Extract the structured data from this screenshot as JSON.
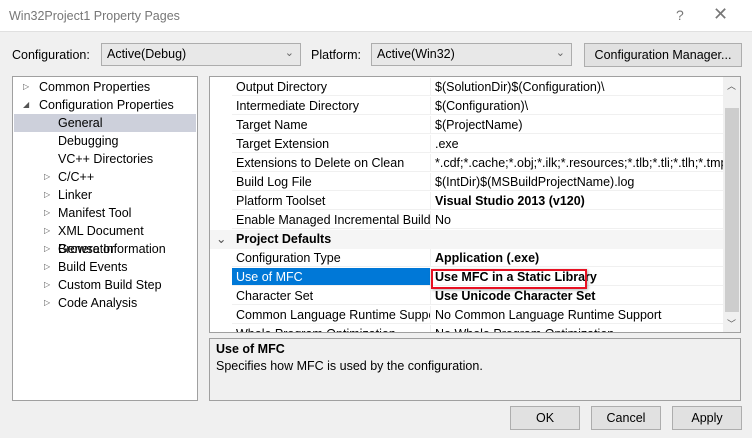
{
  "window": {
    "title": "Win32Project1 Property Pages",
    "help": "?",
    "close": "✕"
  },
  "toolbar": {
    "config_label": "Configuration:",
    "config_value": "Active(Debug)",
    "platform_label": "Platform:",
    "platform_value": "Active(Win32)",
    "config_manager": "Configuration Manager..."
  },
  "tree": [
    {
      "label": "Common Properties",
      "level": 0,
      "state": "collapsed"
    },
    {
      "label": "Configuration Properties",
      "level": 0,
      "state": "expanded"
    },
    {
      "label": "General",
      "level": 1,
      "state": "leaf",
      "selected": true
    },
    {
      "label": "Debugging",
      "level": 1,
      "state": "leaf"
    },
    {
      "label": "VC++ Directories",
      "level": 1,
      "state": "leaf"
    },
    {
      "label": "C/C++",
      "level": 1,
      "state": "collapsed"
    },
    {
      "label": "Linker",
      "level": 1,
      "state": "collapsed"
    },
    {
      "label": "Manifest Tool",
      "level": 1,
      "state": "collapsed"
    },
    {
      "label": "XML Document Generator",
      "level": 1,
      "state": "collapsed"
    },
    {
      "label": "Browse Information",
      "level": 1,
      "state": "collapsed"
    },
    {
      "label": "Build Events",
      "level": 1,
      "state": "collapsed"
    },
    {
      "label": "Custom Build Step",
      "level": 1,
      "state": "collapsed"
    },
    {
      "label": "Code Analysis",
      "level": 1,
      "state": "collapsed"
    }
  ],
  "grid": [
    {
      "name": "Output Directory",
      "value": "$(SolutionDir)$(Configuration)\\"
    },
    {
      "name": "Intermediate Directory",
      "value": "$(Configuration)\\"
    },
    {
      "name": "Target Name",
      "value": "$(ProjectName)"
    },
    {
      "name": "Target Extension",
      "value": ".exe"
    },
    {
      "name": "Extensions to Delete on Clean",
      "value": "*.cdf;*.cache;*.obj;*.ilk;*.resources;*.tlb;*.tli;*.tlh;*.tmp;*.rsp;*.pgc;*.pgd;*.meta;*.tlog;*.manifest;*.res;*.pch;*.exp;*.idb;*.rep;*.xdc;*.pdb;*_manifest.rc;*.bsc;*.sbr;*.xml;*.metagen;*.bi"
    },
    {
      "name": "Build Log File",
      "value": "$(IntDir)$(MSBuildProjectName).log"
    },
    {
      "name": "Platform Toolset",
      "value": "Visual Studio 2013 (v120)",
      "bold": true
    },
    {
      "name": "Enable Managed Incremental Build",
      "value": "No"
    },
    {
      "name": "Project Defaults",
      "category": true
    },
    {
      "name": "Configuration Type",
      "value": "Application (.exe)",
      "bold": true
    },
    {
      "name": "Use of MFC",
      "value": "Use MFC in a Static Library",
      "bold": true,
      "selected": true,
      "highlighted": true
    },
    {
      "name": "Character Set",
      "value": "Use Unicode Character Set",
      "bold": true
    },
    {
      "name": "Common Language Runtime Support",
      "value": "No Common Language Runtime Support"
    },
    {
      "name": "Whole Program Optimization",
      "value": "No Whole Program Optimization"
    }
  ],
  "description": {
    "title": "Use of MFC",
    "text": "Specifies how MFC is used by the configuration."
  },
  "buttons": {
    "ok": "OK",
    "cancel": "Cancel",
    "apply": "Apply"
  },
  "colors": {
    "selection": "#0078d7",
    "tree_selection": "#cdd0db",
    "highlight_box": "#e81123"
  }
}
